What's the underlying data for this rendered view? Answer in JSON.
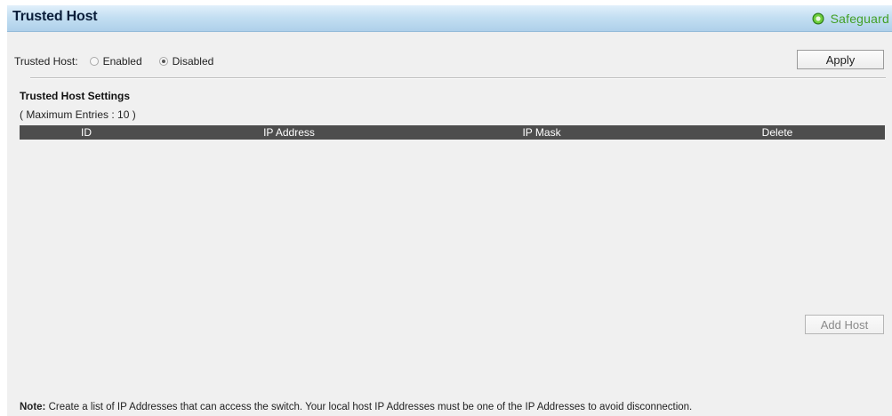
{
  "header": {
    "title": "Trusted Host",
    "safeguard_label": "Safeguard",
    "safeguard_color": "#43a026"
  },
  "trusted_host": {
    "label": "Trusted Host:",
    "options": [
      {
        "label": "Enabled",
        "checked": false
      },
      {
        "label": "Disabled",
        "checked": true
      }
    ],
    "apply_label": "Apply"
  },
  "settings": {
    "title": "Trusted Host Settings",
    "max_entries": "( Maximum Entries : 10 )",
    "columns": [
      "ID",
      "IP Address",
      "IP Mask",
      "Delete"
    ],
    "rows": []
  },
  "add_host_label": "Add Host",
  "note": {
    "prefix": "Note:",
    "text": " Create a list of IP Addresses that can access the switch. Your local host IP Addresses must be one of the IP Addresses to avoid disconnection."
  },
  "colors": {
    "table_header_bg": "#4d4d4d",
    "panel_bg": "#f0f0f0",
    "title_text": "#0b1e3a"
  },
  "icons": {
    "safeguard": "safeguard-indicator-icon"
  }
}
